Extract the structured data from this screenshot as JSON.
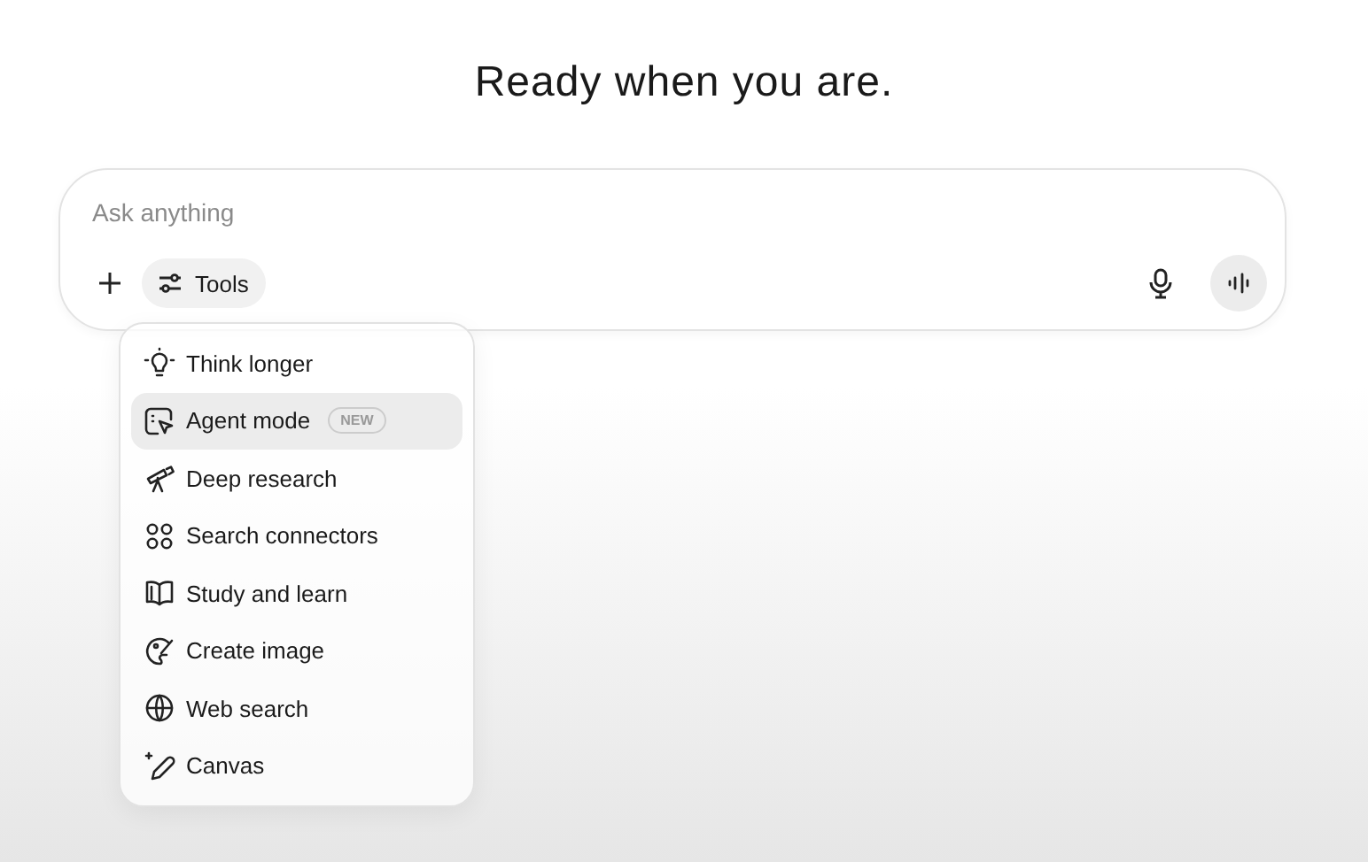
{
  "heading": "Ready when you are.",
  "composer": {
    "placeholder": "Ask anything",
    "tools_label": "Tools"
  },
  "menu": [
    {
      "label": "Think longer",
      "selected": false
    },
    {
      "label": "Agent mode",
      "selected": true,
      "badge": "NEW"
    },
    {
      "label": "Deep research",
      "selected": false
    },
    {
      "label": "Search connectors",
      "selected": false
    },
    {
      "label": "Study and learn",
      "selected": false
    },
    {
      "label": "Create image",
      "selected": false
    },
    {
      "label": "Web search",
      "selected": false
    },
    {
      "label": "Canvas",
      "selected": false
    }
  ]
}
